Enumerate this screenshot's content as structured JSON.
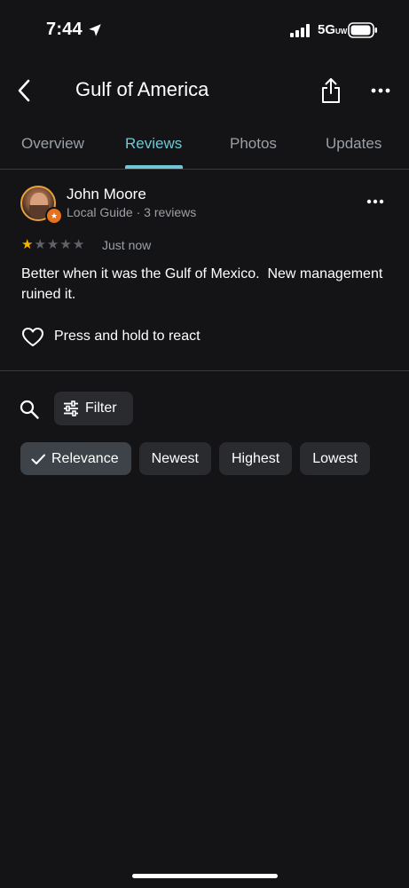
{
  "status_bar": {
    "time": "7:44",
    "network": "5G",
    "network_suffix": "UW"
  },
  "header": {
    "title": "Gulf of America"
  },
  "tabs": [
    {
      "label": "Overview",
      "active": false
    },
    {
      "label": "Reviews",
      "active": true
    },
    {
      "label": "Photos",
      "active": false
    },
    {
      "label": "Updates",
      "active": false
    }
  ],
  "review": {
    "author": "John Moore",
    "meta": "Local Guide · 3 reviews",
    "rating": 1,
    "rating_max": 5,
    "time": "Just now",
    "text": "Better when it was the Gulf of Mexico.  New management ruined it.",
    "react_label": "Press and hold to react"
  },
  "filter": {
    "label": "Filter"
  },
  "sort_chips": [
    {
      "label": "Relevance",
      "selected": true
    },
    {
      "label": "Newest",
      "selected": false
    },
    {
      "label": "Highest",
      "selected": false
    },
    {
      "label": "Lowest",
      "selected": false
    }
  ],
  "icons": {
    "back": "chevron-left-icon",
    "share": "share-icon",
    "more": "more-horizontal-icon",
    "search": "search-icon",
    "filter": "sliders-icon",
    "react": "heart-outline-icon",
    "check": "check-icon"
  },
  "colors": {
    "background": "#141416",
    "accent": "#6fc7d6",
    "star": "#f4b400",
    "local_guide_badge": "#e8711c"
  }
}
